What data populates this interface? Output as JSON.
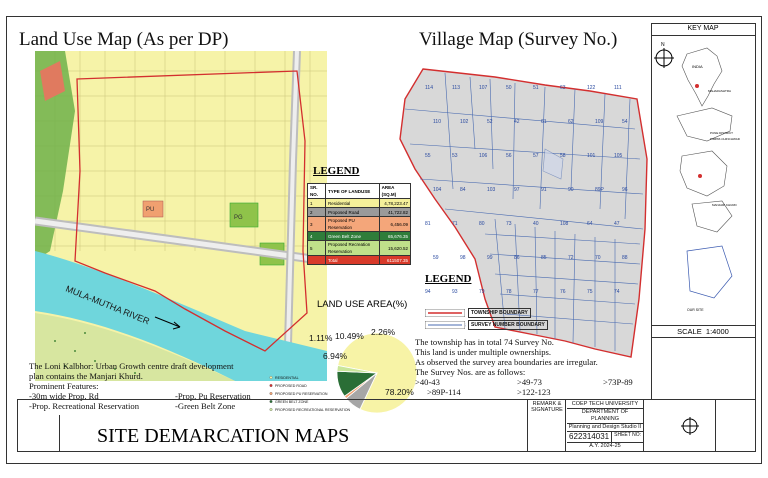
{
  "titles": {
    "land_use": "Land Use Map (As per DP)",
    "village": "Village Map (Survey No.)",
    "key_map": "KEY MAP",
    "sheet": "SITE DEMARCATION MAPS"
  },
  "land_use_map": {
    "river_label": "MULA-MUTHA RIVER",
    "zone_labels": [
      "PG",
      "PU",
      "RC"
    ]
  },
  "land_use_legend": {
    "heading": "LEGEND",
    "columns": [
      "SR. NO.",
      "TYPE OF LANDUSE",
      "AREA (SQ.M)"
    ],
    "rows": [
      {
        "no": "1",
        "type": "Residential",
        "area": "4,78,223.47",
        "color": "#f5f09a"
      },
      {
        "no": "2",
        "type": "Proposed Road",
        "area": "41,722.82",
        "color": "#9a9a9a"
      },
      {
        "no": "3",
        "type": "Proposed PU Reservation",
        "area": "6,456.09",
        "color": "#f4a67a"
      },
      {
        "no": "4",
        "type": "Green Belt Zone",
        "area": "65,676.35",
        "color": "#2f7d3a"
      },
      {
        "no": "5",
        "type": "Proposed Recreation Reservation",
        "area": "15,620.52",
        "color": "#bfe08a"
      },
      {
        "no": "",
        "type": "Total",
        "area": "611507.35",
        "color": "#d83a2a"
      }
    ]
  },
  "chart_data": {
    "type": "pie",
    "title": "LAND USE AREA(%)",
    "categories": [
      "RESIDENTIAL",
      "PROPOSED ROAD",
      "PROPOSED PU RESERVATION",
      "GREEN BELT ZONE",
      "PROPOSED RECREATIONAL RESERVATION"
    ],
    "values": [
      78.2,
      6.94,
      1.11,
      10.49,
      2.26
    ],
    "labels": [
      "78.20%",
      "6.94%",
      "1.11%",
      "10.49%",
      "2.26%"
    ],
    "colors": [
      "#f7f3a6",
      "#a6a6a6",
      "#f0a070",
      "#2a6e36",
      "#c9e69a"
    ],
    "legend_position": "left"
  },
  "description": {
    "lines": [
      "The Loni Kalbhor: Urban Growth centre draft development",
      "plan contains the Manjari Khurd.",
      "Prominent Features:"
    ],
    "features_left": [
      "-30m wide Prop. Rd",
      "-Prop. Recreational Reservation"
    ],
    "features_right": [
      "-Prop. Pu Reservation",
      "-Green Belt Zone"
    ]
  },
  "village_legend": {
    "heading": "LEGEND",
    "items": [
      "TOWNSHIP BOUNDARY",
      "SURVEY NUMBER BOUNDARY"
    ]
  },
  "survey_text": {
    "lines": [
      "The township has in total 74 Survey No.",
      "This land is under multiple ownerships.",
      "As observed the survey area boundaries are irregular.",
      "The Survey Nos. are as follows:"
    ],
    "ranges": [
      ">40-43",
      ">49-73",
      ">73P-89",
      ">89P-114",
      ">122-123"
    ]
  },
  "survey_numbers": [
    "114",
    "113",
    "107",
    "50",
    "51",
    "63",
    "122",
    "111",
    "110",
    "102",
    "52",
    "42",
    "61",
    "62",
    "109",
    "54",
    "55",
    "53",
    "106",
    "56",
    "57",
    "58",
    "101",
    "105",
    "104",
    "84",
    "103",
    "97",
    "91",
    "90",
    "89P",
    "96",
    "81",
    "71",
    "80",
    "73",
    "40",
    "108",
    "64",
    "47",
    "59",
    "98",
    "99",
    "86",
    "85",
    "72",
    "70",
    "88",
    "94",
    "93",
    "79",
    "78",
    "77",
    "76",
    "75",
    "74",
    "69",
    "68"
  ],
  "key_map": {
    "labels": [
      "INDIA",
      "MAHARASHTRA",
      "PUNE DISTRICT",
      "PIMPRI-CHINCHWAD",
      "MANJARI KHURD",
      "OUR SITE"
    ]
  },
  "scale": "SCALE  1:4000",
  "title_block": {
    "remark": "REMARK & SIGNATURE",
    "university": "COEP TECH UNIVERSITY",
    "department": "DEPARTMENT OF PLANNING",
    "studio": "Planning and Design Studio II",
    "id": "622314031",
    "sheet_no": "SHEET NO:",
    "year": "A.Y. 2024-25"
  },
  "icons": [
    "north-arrow-icon"
  ]
}
